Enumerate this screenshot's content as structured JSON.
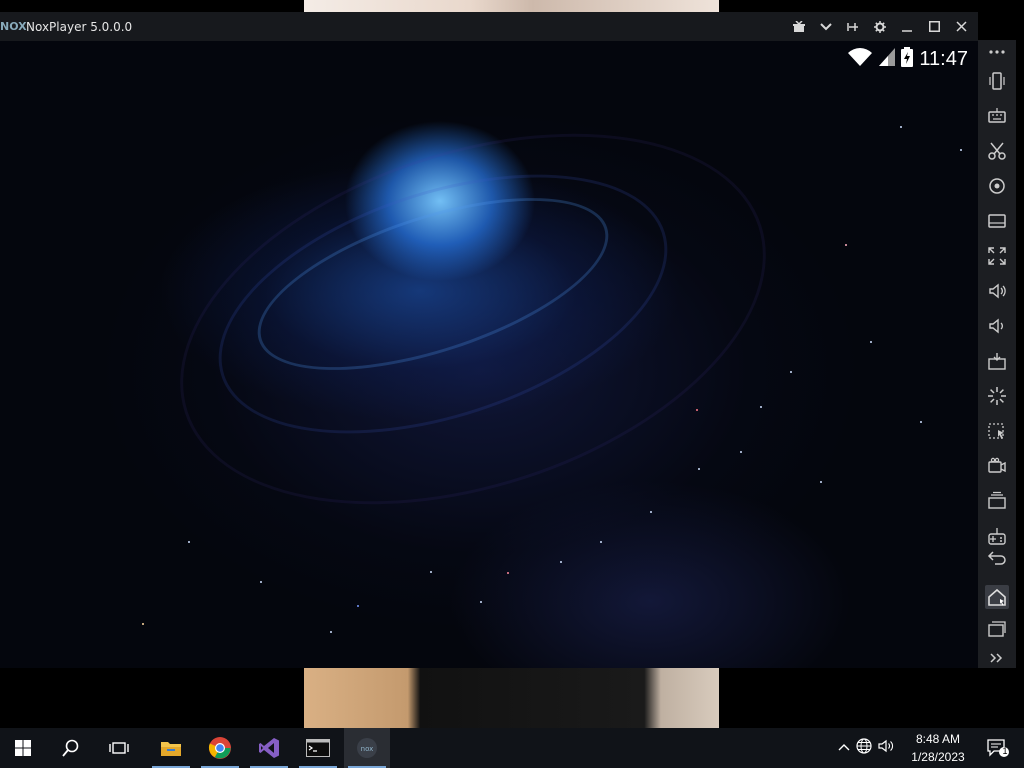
{
  "window": {
    "logo_text": "NOX",
    "title": "NoxPlayer 5.0.0.0",
    "controls": [
      "gift-icon",
      "chevron-down-icon",
      "pin-icon",
      "gear-icon",
      "minimize-icon",
      "maximize-icon",
      "close-icon"
    ]
  },
  "android": {
    "status": {
      "time": "11:47",
      "icons": [
        "wifi-icon",
        "signal-icon",
        "battery-charging-icon"
      ]
    }
  },
  "toolbar": {
    "items": [
      "more-icon",
      "shake-icon",
      "keyboard-icon",
      "scissors-icon",
      "location-icon",
      "screen-icon",
      "fullscreen-icon",
      "volume-up-icon",
      "volume-down-icon",
      "apk-install-icon",
      "loading-icon",
      "macro-icon",
      "video-record-icon",
      "multi-instance-icon",
      "keymap-icon",
      "back-icon",
      "home-icon",
      "recent-apps-icon",
      "expand-icon"
    ]
  },
  "taskbar": {
    "apps": [
      "windows-start-icon",
      "search-icon",
      "task-view-icon",
      "file-explorer-icon",
      "chrome-icon",
      "visual-studio-icon",
      "terminal-icon",
      "nox-icon"
    ],
    "time": "8:48 AM",
    "date": "1/28/2023",
    "notification_count": "1",
    "colors": {
      "accent": "#7aa7d8",
      "taskbar_bg": "#101318"
    }
  }
}
